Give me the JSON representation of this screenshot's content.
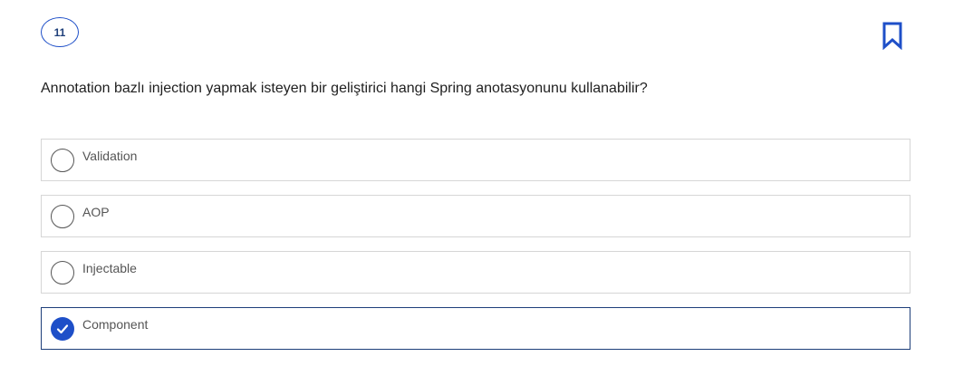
{
  "question": {
    "number": "11",
    "text": "Annotation bazlı injection yapmak isteyen bir geliştirici hangi Spring anotasyonunu kullanabilir?",
    "bookmark_icon": "bookmark-icon"
  },
  "options": [
    {
      "label": "Validation",
      "selected": false
    },
    {
      "label": "AOP",
      "selected": false
    },
    {
      "label": "Injectable",
      "selected": false
    },
    {
      "label": "Component",
      "selected": true
    }
  ],
  "colors": {
    "accent": "#1e4fc8",
    "selected_border": "#1e3f7a",
    "option_border": "#d6d6d6"
  }
}
